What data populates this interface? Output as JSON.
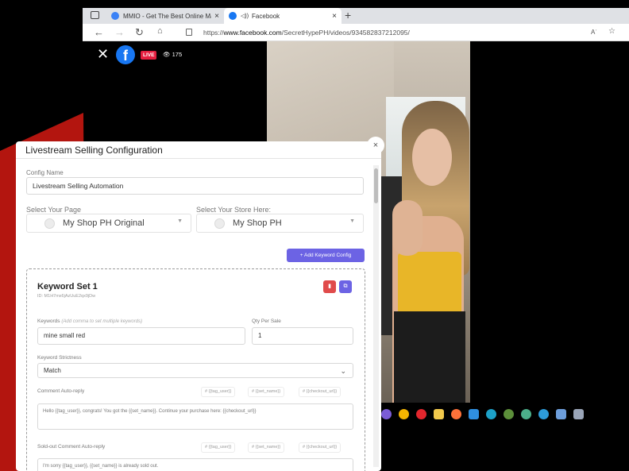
{
  "browser": {
    "tabs": [
      {
        "title": "MMIO - Get The Best Online Ma",
        "close": "×"
      },
      {
        "title": "Facebook",
        "close": "×",
        "audio": "◁))"
      }
    ],
    "new_tab": "+",
    "url_base": "https://",
    "url_host": "www.facebook.com",
    "url_path": "/SecretHypePH/videos/934582837212095/",
    "read_aloud": "Aʾ",
    "favorites": "☆"
  },
  "facebook": {
    "close": "✕",
    "logo": "f",
    "live_label": "LIVE",
    "viewer_count": "175",
    "viewer_icon": "eye-icon"
  },
  "modal": {
    "title": "Livestream Selling Configuration",
    "close": "×",
    "config_name_label": "Config Name",
    "config_name_value": "Livestream Selling Automation",
    "page_label": "Select Your Page",
    "page_value": "My Shop PH Original",
    "store_label": "Select Your Store Here:",
    "store_value": "My Shop PH",
    "add_keyword_btn": "+ Add Keyword Config",
    "keyword_set": {
      "title": "Keyword Set 1",
      "id": "ID: M1H7mx6jAzUuE2qx9jDw",
      "keywords_label": "Keywords",
      "keywords_hint": "(Add comma to set multiple keywords)",
      "keywords_value": "mine small red",
      "qty_label": "Qty Per Sale",
      "qty_value": "1",
      "strictness_label": "Keyword Strictness",
      "strictness_value": "Match",
      "comment_label": "Comment Auto-reply",
      "chips": [
        "# {{tag_user}}",
        "# {{set_name}}",
        "# {{checkout_url}}"
      ],
      "comment_text": "Hello {{tag_user}}, congrats! You got the {{set_name}}. Continue your purchase here: {{checkout_url}}",
      "soldout_label": "Sold-out Comment Auto-reply",
      "soldout_chips": [
        "# {{tag_user}}",
        "# {{set_name}}",
        "# {{checkout_url}}"
      ],
      "soldout_text": "I'm sorry {{tag_user}}, {{set_name}} is already sold out."
    }
  },
  "colors": {
    "accent": "#6c63e4",
    "danger": "#e04b4b",
    "facebook_blue": "#1877f2",
    "live_red": "#e41e3f",
    "brand_red": "#b3150f"
  },
  "taskbar_icons": [
    "skype-icon",
    "chrome-icon",
    "opera-icon",
    "files-icon",
    "firefox-icon",
    "vscode-icon",
    "edge-icon",
    "app-icon-1",
    "app-icon-2",
    "app-icon-3",
    "app-icon-4",
    "app-icon-5"
  ]
}
